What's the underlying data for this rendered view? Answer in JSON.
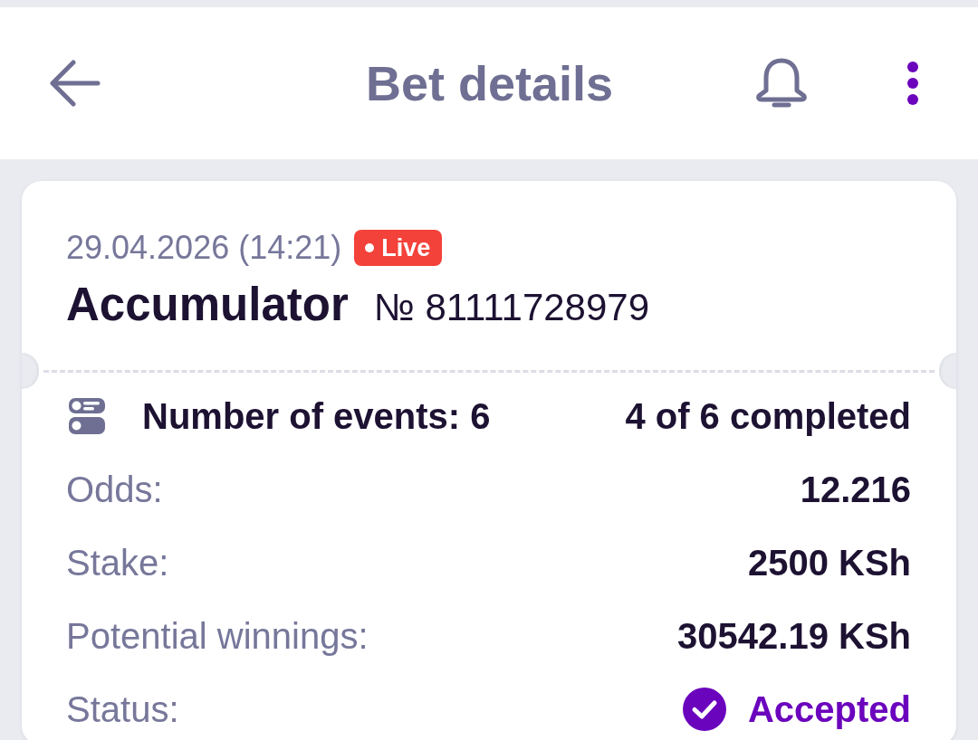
{
  "header": {
    "title": "Bet details"
  },
  "bet": {
    "date": "29.04.2026 (14:21)",
    "badge": "Live",
    "type": "Accumulator",
    "number": "№ 81111728979"
  },
  "events": {
    "label": "Number of events: 6",
    "completed_text": "4 of 6 completed"
  },
  "details": [
    {
      "kind": "plain",
      "label": "Odds:",
      "value": "12.216"
    },
    {
      "kind": "plain",
      "label": "Stake:",
      "value": "2500 KSh"
    },
    {
      "kind": "plain",
      "label": "Potential winnings:",
      "value": "30542.19 KSh"
    },
    {
      "kind": "status",
      "label": "Status:",
      "value": "Accepted"
    }
  ]
}
